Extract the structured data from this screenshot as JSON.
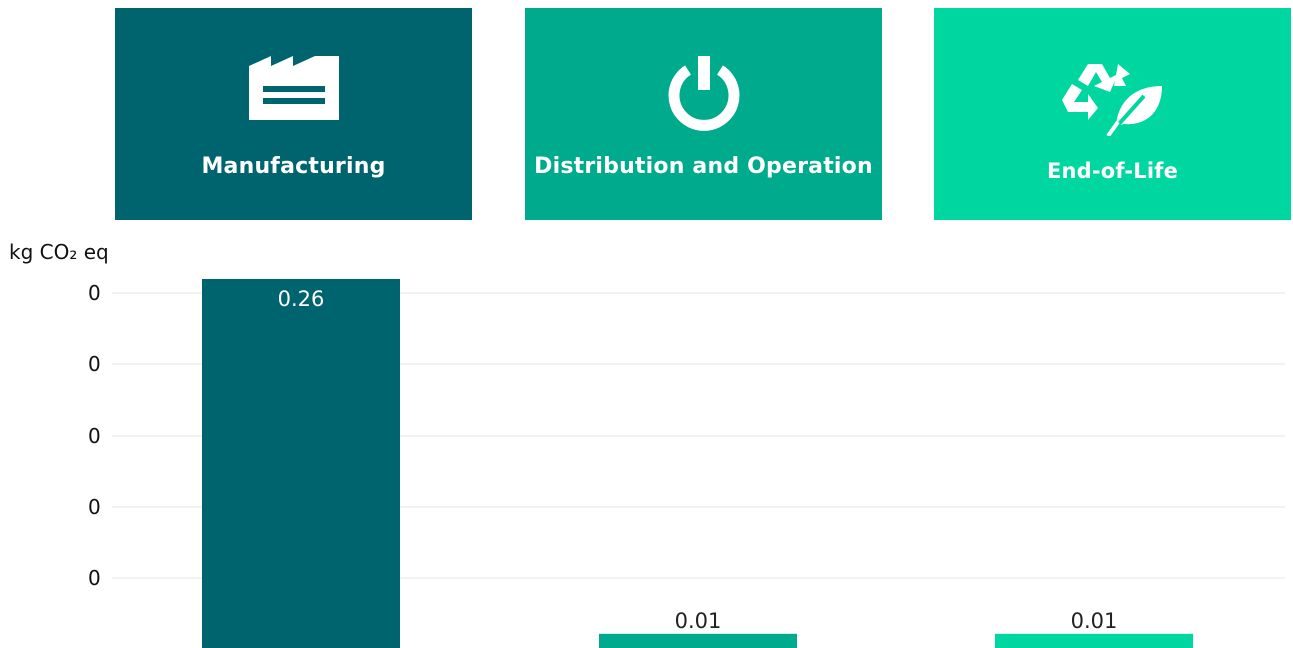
{
  "phases": [
    {
      "label": "Manufacturing",
      "icon": "factory-icon",
      "color": "#00646e"
    },
    {
      "label": "Distribution and Operation",
      "icon": "power-icon",
      "color": "#00aa8c"
    },
    {
      "label": "End-of-Life",
      "icon": "recycle-leaf-icon",
      "color": "#00d7a0"
    }
  ],
  "chart_data": {
    "type": "bar",
    "categories": [
      "Manufacturing",
      "Distribution and Operation",
      "End-of-Life"
    ],
    "values": [
      0.26,
      0.01,
      0.01
    ],
    "value_labels": [
      "0.26",
      "0.01",
      "0.01"
    ],
    "bar_colors": [
      "#00646e",
      "#00aa8c",
      "#00d7a0"
    ],
    "ylabel": "kg CO₂ eq",
    "ytick_labels": [
      "0",
      "0",
      "0",
      "0",
      "0"
    ],
    "ylim": [
      0,
      0.26
    ],
    "grid": true,
    "legend": "none"
  }
}
